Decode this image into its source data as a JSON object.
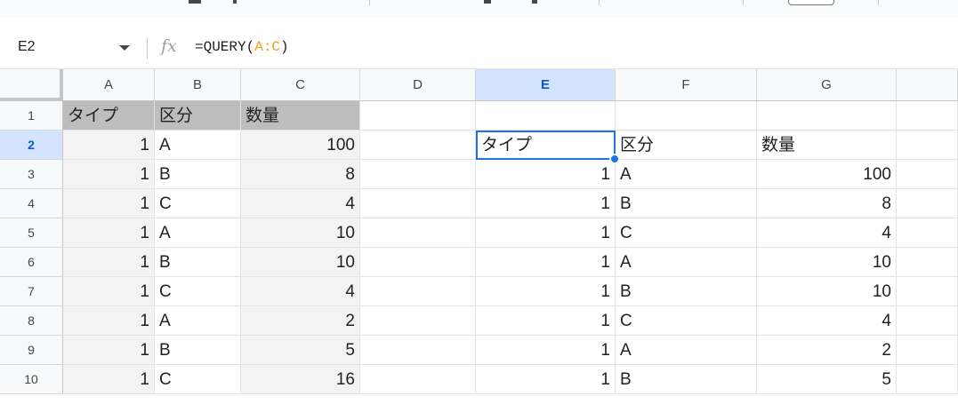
{
  "toolbar": {},
  "formula_bar": {
    "name_box": "E2",
    "formula_prefix": "=QUERY(",
    "formula_ref": "A:C",
    "formula_suffix": ")"
  },
  "columns": [
    "A",
    "B",
    "C",
    "D",
    "E",
    "F",
    "G"
  ],
  "selected_column": "E",
  "rows": [
    "1",
    "2",
    "3",
    "4",
    "5",
    "6",
    "7",
    "8",
    "9",
    "10"
  ],
  "selected_row": "2",
  "active_cell": "E2",
  "source_table": {
    "headers": [
      "タイプ",
      "区分",
      "数量"
    ],
    "data": [
      [
        "1",
        "A",
        "100"
      ],
      [
        "1",
        "B",
        "8"
      ],
      [
        "1",
        "C",
        "4"
      ],
      [
        "1",
        "A",
        "10"
      ],
      [
        "1",
        "B",
        "10"
      ],
      [
        "1",
        "C",
        "4"
      ],
      [
        "1",
        "A",
        "2"
      ],
      [
        "1",
        "B",
        "5"
      ],
      [
        "1",
        "C",
        "16"
      ]
    ]
  },
  "query_result": {
    "headers": [
      "タイプ",
      "区分",
      "数量"
    ],
    "data": [
      [
        "1",
        "A",
        "100"
      ],
      [
        "1",
        "B",
        "8"
      ],
      [
        "1",
        "C",
        "4"
      ],
      [
        "1",
        "A",
        "10"
      ],
      [
        "1",
        "B",
        "10"
      ],
      [
        "1",
        "C",
        "4"
      ],
      [
        "1",
        "A",
        "2"
      ],
      [
        "1",
        "B",
        "5"
      ]
    ]
  },
  "colors": {
    "selection": "#1a73e8",
    "header_fill": "#bdbdbd",
    "alt_fill": "#f3f3f3",
    "selected_header": "#d3e3fd",
    "formula_ref": "#f29c1b"
  }
}
